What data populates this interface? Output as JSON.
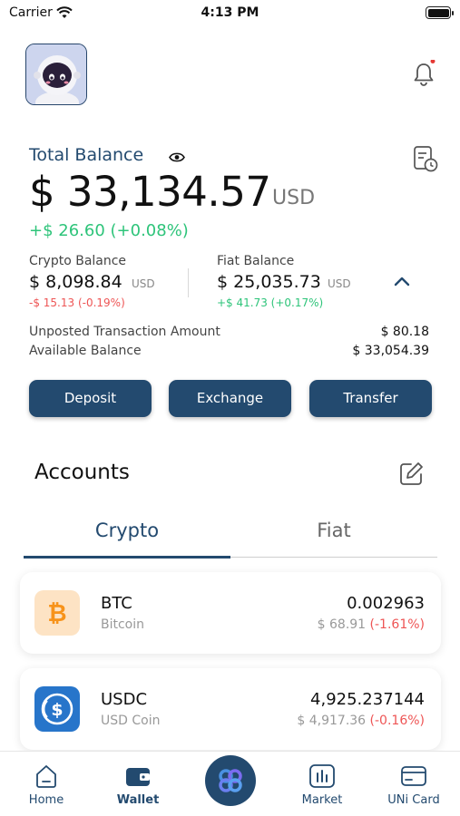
{
  "status_bar": {
    "carrier": "Carrier",
    "time": "4:13 PM"
  },
  "balance": {
    "title": "Total Balance",
    "amount": "$ 33,134.57",
    "currency": "USD",
    "change": "+$ 26.60 (+0.08%)",
    "crypto": {
      "label": "Crypto Balance",
      "amount": "$ 8,098.84",
      "currency": "USD",
      "change": "-$ 15.13 (-0.19%)"
    },
    "fiat": {
      "label": "Fiat Balance",
      "amount": "$ 25,035.73",
      "currency": "USD",
      "change": "+$ 41.73 (+0.17%)"
    },
    "unposted": {
      "label": "Unposted Transaction Amount",
      "value": "$ 80.18"
    },
    "available": {
      "label": "Available Balance",
      "value": "$ 33,054.39"
    }
  },
  "actions": {
    "deposit": "Deposit",
    "exchange": "Exchange",
    "transfer": "Transfer"
  },
  "accounts": {
    "title": "Accounts",
    "tabs": [
      "Crypto",
      "Fiat"
    ],
    "active_tab": "Crypto",
    "items": [
      {
        "symbol": "BTC",
        "name": "Bitcoin",
        "quantity": "0.002963",
        "fiat_value": "$ 68.91",
        "change": "(-1.61%)",
        "icon": "bitcoin-icon"
      },
      {
        "symbol": "USDC",
        "name": "USD Coin",
        "quantity": "4,925.237144",
        "fiat_value": "$ 4,917.36",
        "change": "(-0.16%)",
        "icon": "usdc-icon"
      }
    ]
  },
  "tabbar": {
    "items": [
      "Home",
      "Wallet",
      "Market",
      "UNi Card"
    ],
    "active": "Wallet"
  },
  "colors": {
    "primary": "#234a6f",
    "positive": "#2ec47a",
    "negative": "#ee5555",
    "bitcoin": "#f7931a",
    "usdc": "#2775ca"
  }
}
